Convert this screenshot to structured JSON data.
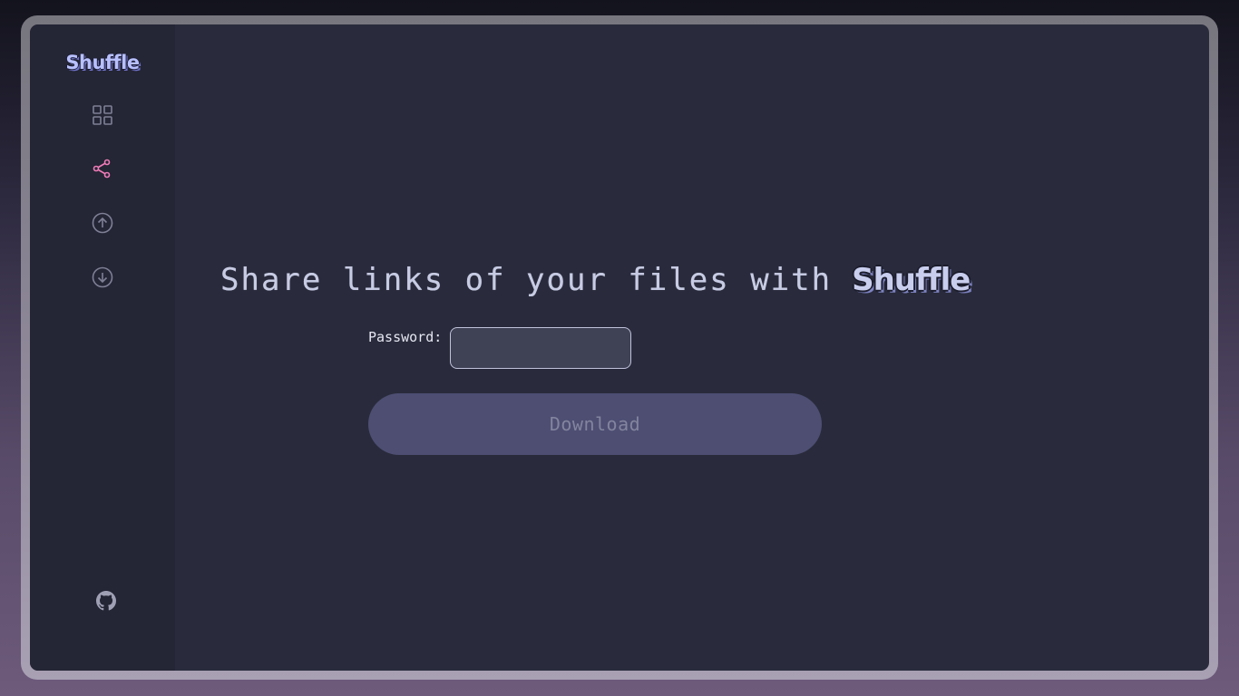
{
  "app": {
    "logo_text": "Shuffle"
  },
  "sidebar": {
    "items": [
      {
        "name": "dashboard",
        "icon": "grid-icon",
        "active": false
      },
      {
        "name": "share",
        "icon": "share-icon",
        "active": true
      },
      {
        "name": "upload",
        "icon": "arrow-up-circle-icon",
        "active": false
      },
      {
        "name": "download",
        "icon": "arrow-down-circle-icon",
        "active": false
      }
    ],
    "footer_icon": "github-icon"
  },
  "main": {
    "heading_text": "Share links of your files with",
    "heading_brand": "Shuffle",
    "password_label": "Password:",
    "password_value": "",
    "download_label": "Download"
  },
  "colors": {
    "accent_active": "#f07cb8",
    "icon_default": "#7f8095",
    "button_bg": "#4d4e72",
    "button_text": "#83849e"
  }
}
